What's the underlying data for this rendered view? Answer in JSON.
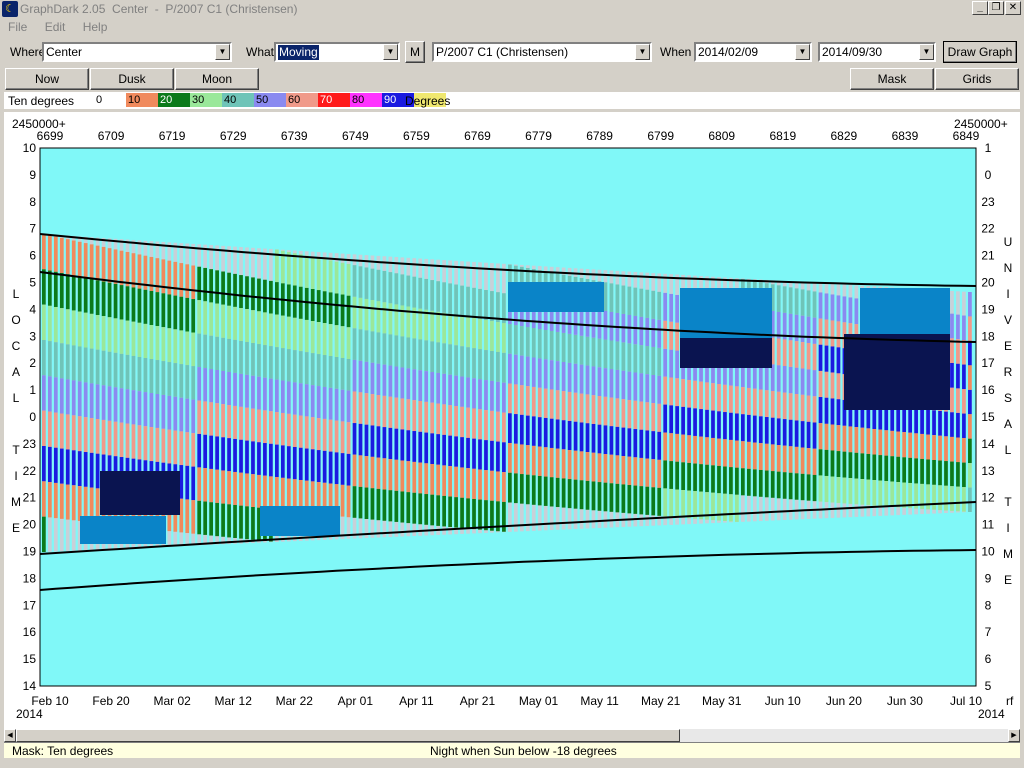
{
  "window": {
    "title": "GraphDark 2.05  Center  -  P/2007 C1 (Christensen)",
    "icon": "moon-face-icon",
    "controls": [
      "_",
      "❐",
      "✕"
    ]
  },
  "menu": [
    "File",
    "Edit",
    "Help"
  ],
  "toolbar": {
    "where_label": "Where",
    "where_value": "Center",
    "what_label": "What",
    "what_value": "Moving",
    "m_button": "M",
    "object_value": "P/2007 C1 (Christensen)",
    "when_label": "When",
    "start_date": "2014/02/09",
    "end_date": "2014/09/30",
    "draw_button": "Draw Graph"
  },
  "buttons": {
    "now": "Now",
    "dusk": "Dusk",
    "moon": "Moon",
    "mask": "Mask",
    "grids": "Grids"
  },
  "legend": {
    "label": "Ten degrees",
    "unit": "Degrees",
    "items": [
      {
        "text": "0",
        "color": "#ffffff"
      },
      {
        "text": "10",
        "color": "#f08a5d"
      },
      {
        "text": "20",
        "color": "#0b7a1a"
      },
      {
        "text": "30",
        "color": "#9ae89a"
      },
      {
        "text": "40",
        "color": "#6fc4b8"
      },
      {
        "text": "50",
        "color": "#8a8af0"
      },
      {
        "text": "60",
        "color": "#f09a8a"
      },
      {
        "text": "70",
        "color": "#ff1a1a"
      },
      {
        "text": "80",
        "color": "#ff33ff"
      },
      {
        "text": "90",
        "color": "#1a1ae0"
      },
      {
        "text": "",
        "color": "#f0e870"
      }
    ]
  },
  "chart_data": {
    "type": "heatmap",
    "jd_prefix": "2450000+",
    "top_ticks": [
      "6699",
      "6709",
      "6719",
      "6729",
      "6739",
      "6749",
      "6759",
      "6769",
      "6779",
      "6789",
      "6799",
      "6809",
      "6819",
      "6829",
      "6839",
      "6849"
    ],
    "bottom_ticks": [
      "Feb 10",
      "Feb 20",
      "Mar 02",
      "Mar 12",
      "Mar 22",
      "Apr 01",
      "Apr 11",
      "Apr 21",
      "May 01",
      "May 11",
      "May 21",
      "May 31",
      "Jun 10",
      "Jun 20",
      "Jun 30",
      "Jul 10"
    ],
    "bottom_right_label": "rf",
    "year_left": "2014",
    "year_right": "2014",
    "left_axis_ticks": [
      "10",
      "9",
      "8",
      "7",
      "6",
      "5",
      "4",
      "3",
      "2",
      "1",
      "0",
      "23",
      "22",
      "21",
      "20",
      "19",
      "18",
      "17",
      "16",
      "15",
      "14"
    ],
    "right_axis_ticks": [
      "1",
      "0",
      "23",
      "22",
      "21",
      "20",
      "19",
      "18",
      "17",
      "16",
      "15",
      "14",
      "13",
      "12",
      "11",
      "10",
      "9",
      "8",
      "7",
      "6",
      "5"
    ],
    "left_axis_title": [
      "L",
      "O",
      "C",
      "A",
      "L",
      "",
      "T",
      "I",
      "M",
      "E"
    ],
    "right_axis_title": [
      "U",
      "N",
      "I",
      "V",
      "E",
      "R",
      "S",
      "A",
      "L",
      "",
      "T",
      "I",
      "M",
      "E"
    ],
    "day_background": "#80f8f8",
    "colors": {
      "twilight": "#0a84c8",
      "night": "#0a1450",
      "below": "#c8d0d8"
    }
  },
  "status": {
    "left": "Mask:  Ten degrees",
    "center": "Night when Sun below -18 degrees"
  }
}
